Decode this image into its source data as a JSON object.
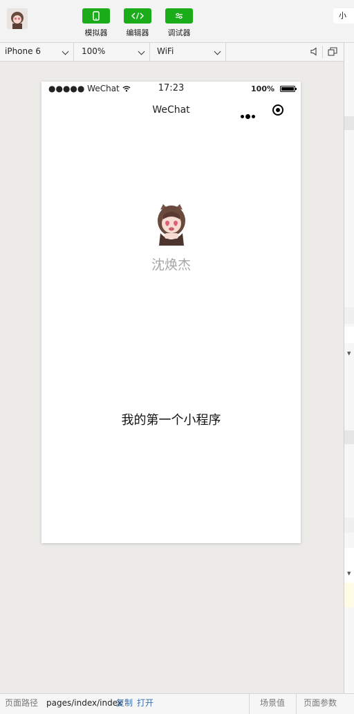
{
  "toolbar": {
    "simulator_label": "模拟器",
    "editor_label": "编辑器",
    "debugger_label": "调试器",
    "right_clip": "小"
  },
  "device_bar": {
    "device": "iPhone 6",
    "zoom": "100%",
    "network": "WiFi"
  },
  "phone": {
    "status": {
      "carrier": "●●●●● WeChat",
      "time": "17:23",
      "battery": "100%"
    },
    "nav_title": "WeChat",
    "nickname": "沈焕杰",
    "motto": "我的第一个小程序"
  },
  "bottom_bar": {
    "path_label": "页面路径",
    "path_value": "pages/index/index",
    "copy": "复制",
    "open": "打开",
    "scene": "场景值",
    "params": "页面参数"
  },
  "colors": {
    "accent_green": "#1aad19",
    "nickname_gray": "#a6a6a6",
    "canvas": "#ecebe8"
  },
  "icons": [
    "avatar-icon",
    "phone-icon",
    "code-icon",
    "sliders-icon",
    "chevron-down-icon",
    "speaker-icon",
    "detach-window-icon",
    "wifi-icon",
    "battery-icon",
    "more-dots-icon",
    "close-target-icon"
  ]
}
